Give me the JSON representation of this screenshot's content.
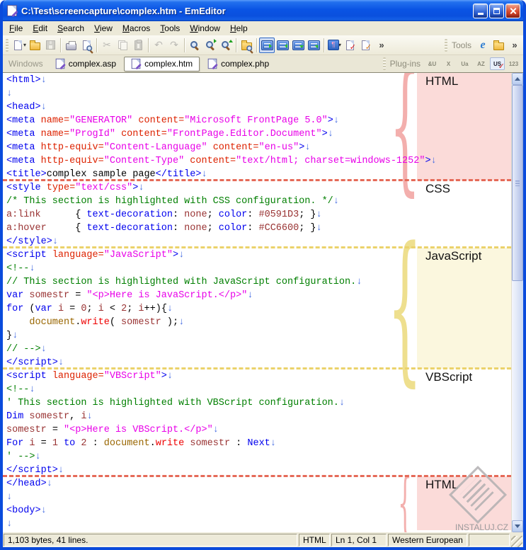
{
  "window": {
    "title": "C:\\Test\\screencapture\\complex.htm - EmEditor"
  },
  "menu": {
    "items": [
      "File",
      "Edit",
      "Search",
      "View",
      "Macros",
      "Tools",
      "Window",
      "Help"
    ]
  },
  "toolbar": {
    "main": [
      {
        "name": "new-file",
        "icon": "page",
        "dropdown": true
      },
      {
        "name": "open-file",
        "icon": "folder"
      },
      {
        "name": "save-file",
        "icon": "floppy",
        "disabled": true
      },
      {
        "sep": true
      },
      {
        "name": "print",
        "icon": "printer"
      },
      {
        "name": "print-preview",
        "icon": "preview"
      },
      {
        "sep": true
      },
      {
        "name": "cut",
        "icon": "scissors",
        "disabled": true
      },
      {
        "name": "copy",
        "icon": "copy",
        "disabled": true
      },
      {
        "name": "paste",
        "icon": "paste",
        "disabled": true
      },
      {
        "sep": true
      },
      {
        "name": "undo",
        "icon": "undo",
        "disabled": true
      },
      {
        "name": "redo",
        "icon": "redo",
        "disabled": true
      },
      {
        "sep": true
      },
      {
        "name": "find",
        "icon": "lens"
      },
      {
        "name": "find-next",
        "icon": "lens-next"
      },
      {
        "name": "find-previous",
        "icon": "lens-prev"
      },
      {
        "sep": true
      },
      {
        "name": "find-in-files",
        "icon": "lens-folder"
      },
      {
        "sep": true
      },
      {
        "name": "no-wrap",
        "icon": "wrap1",
        "selected": true
      },
      {
        "name": "wrap-by-characters",
        "icon": "wrap2"
      },
      {
        "name": "wrap-by-window",
        "icon": "wrap3"
      },
      {
        "name": "wrap-by-page",
        "icon": "wrap4"
      },
      {
        "sep": true
      },
      {
        "name": "show-marks",
        "icon": "marks",
        "dropdown": true
      },
      {
        "name": "quick-macro-record",
        "icon": "macro1"
      },
      {
        "name": "quick-macro-run",
        "icon": "macro2"
      },
      {
        "name": "toolbar-overflow",
        "icon": "chevron"
      }
    ],
    "tools": {
      "label": "Tools",
      "items": [
        {
          "name": "external-tool-internet-explorer",
          "icon": "ie"
        },
        {
          "name": "external-tool-folder",
          "icon": "folder"
        },
        {
          "name": "tools-overflow",
          "icon": "chevron"
        }
      ]
    }
  },
  "tabbar": {
    "windows_label": "Windows",
    "tabs": [
      {
        "label": "complex.asp",
        "active": false
      },
      {
        "label": "complex.htm",
        "active": true
      },
      {
        "label": "complex.php",
        "active": false
      }
    ],
    "plugins_label": "Plug-ins",
    "plugin_icons": [
      {
        "name": "plugin-decode-selection",
        "glyph": "&U",
        "disabled": true
      },
      {
        "name": "plugin-delete-blank-lines",
        "glyph": "X",
        "disabled": true
      },
      {
        "name": "plugin-unicode-convert",
        "glyph": "Ua",
        "disabled": true
      },
      {
        "name": "plugin-sort-az",
        "glyph": "AZ",
        "disabled": true
      },
      {
        "name": "plugin-spelling-us",
        "glyph": "US",
        "disabled": false,
        "check": true
      },
      {
        "name": "plugin-word-count",
        "glyph": "123",
        "disabled": true
      }
    ]
  },
  "editor": {
    "sections": [
      {
        "label": "HTML",
        "highlight": "pink",
        "brace": true,
        "separator_after": "red",
        "lines": [
          [
            [
              "tag",
              "<html>"
            ],
            [
              "nl",
              "↓"
            ]
          ],
          [
            [
              "nl",
              "↓"
            ]
          ],
          [
            [
              "tag",
              "<head>"
            ],
            [
              "nl",
              "↓"
            ]
          ],
          [
            [
              "tag",
              "<meta"
            ],
            [
              "pln",
              " "
            ],
            [
              "attr",
              "name="
            ],
            [
              "val",
              "\"GENERATOR\""
            ],
            [
              "pln",
              " "
            ],
            [
              "attr",
              "content="
            ],
            [
              "val",
              "\"Microsoft FrontPage 5.0\""
            ],
            [
              "tag",
              ">"
            ],
            [
              "nl",
              "↓"
            ]
          ],
          [
            [
              "tag",
              "<meta"
            ],
            [
              "pln",
              " "
            ],
            [
              "attr",
              "name="
            ],
            [
              "val",
              "\"ProgId\""
            ],
            [
              "pln",
              " "
            ],
            [
              "attr",
              "content="
            ],
            [
              "val",
              "\"FrontPage.Editor.Document\""
            ],
            [
              "tag",
              ">"
            ],
            [
              "nl",
              "↓"
            ]
          ],
          [
            [
              "tag",
              "<meta"
            ],
            [
              "pln",
              " "
            ],
            [
              "attr",
              "http-equiv="
            ],
            [
              "val",
              "\"Content-Language\""
            ],
            [
              "pln",
              " "
            ],
            [
              "attr",
              "content="
            ],
            [
              "val",
              "\"en-us\""
            ],
            [
              "tag",
              ">"
            ],
            [
              "nl",
              "↓"
            ]
          ],
          [
            [
              "tag",
              "<meta"
            ],
            [
              "pln",
              " "
            ],
            [
              "attr",
              "http-equiv="
            ],
            [
              "val",
              "\"Content-Type\""
            ],
            [
              "pln",
              " "
            ],
            [
              "attr",
              "content="
            ],
            [
              "val",
              "\"text/html; charset=windows-1252\""
            ],
            [
              "tag",
              ">"
            ],
            [
              "nl",
              "↓"
            ]
          ],
          [
            [
              "tag",
              "<title>"
            ],
            [
              "pln",
              "complex sample page"
            ],
            [
              "tag",
              "</title>"
            ],
            [
              "nl",
              "↓"
            ]
          ]
        ]
      },
      {
        "label": "CSS",
        "highlight": null,
        "brace": false,
        "separator_after": "yellow",
        "lines": [
          [
            [
              "tag",
              "<style"
            ],
            [
              "pln",
              " "
            ],
            [
              "attr",
              "type="
            ],
            [
              "val",
              "\"text/css\""
            ],
            [
              "tag",
              ">"
            ],
            [
              "nl",
              "↓"
            ]
          ],
          [
            [
              "cmt",
              "/* This section is highlighted with CSS configuration. */"
            ],
            [
              "nl",
              "↓"
            ]
          ],
          [
            [
              "id",
              "a:link"
            ],
            [
              "pln",
              "      { "
            ],
            [
              "kw",
              "text-decoration"
            ],
            [
              "pln",
              ": "
            ],
            [
              "id",
              "none"
            ],
            [
              "pln",
              "; "
            ],
            [
              "kw",
              "color"
            ],
            [
              "pln",
              ": "
            ],
            [
              "id",
              "#0591D3"
            ],
            [
              "pln",
              "; }"
            ],
            [
              "nl",
              "↓"
            ]
          ],
          [
            [
              "id",
              "a:hover"
            ],
            [
              "pln",
              "     { "
            ],
            [
              "kw",
              "text-decoration"
            ],
            [
              "pln",
              ": "
            ],
            [
              "id",
              "none"
            ],
            [
              "pln",
              "; "
            ],
            [
              "kw",
              "color"
            ],
            [
              "pln",
              ": "
            ],
            [
              "id",
              "#CC6600"
            ],
            [
              "pln",
              "; }"
            ],
            [
              "nl",
              "↓"
            ]
          ],
          [
            [
              "tag",
              "</style>"
            ],
            [
              "nl",
              "↓"
            ]
          ]
        ]
      },
      {
        "label": "JavaScript",
        "highlight": "yellow",
        "brace": true,
        "separator_after": "yellow",
        "lines": [
          [
            [
              "tag",
              "<script"
            ],
            [
              "pln",
              " "
            ],
            [
              "attr",
              "language="
            ],
            [
              "val",
              "\"JavaScript\""
            ],
            [
              "tag",
              ">"
            ],
            [
              "nl",
              "↓"
            ]
          ],
          [
            [
              "cmt",
              "<!--"
            ],
            [
              "nl",
              "↓"
            ]
          ],
          [
            [
              "cmt",
              "// This section is highlighted with JavaScript configuration."
            ],
            [
              "nl",
              "↓"
            ]
          ],
          [
            [
              "kw",
              "var"
            ],
            [
              "pln",
              " "
            ],
            [
              "id",
              "somestr"
            ],
            [
              "pln",
              " = "
            ],
            [
              "str",
              "\"<p>Here is JavaScript.</p>\""
            ],
            [
              "nl",
              "↓"
            ]
          ],
          [
            [
              "kw",
              "for"
            ],
            [
              "pln",
              " ("
            ],
            [
              "kw",
              "var"
            ],
            [
              "pln",
              " "
            ],
            [
              "id",
              "i"
            ],
            [
              "pln",
              " = "
            ],
            [
              "id",
              "0"
            ],
            [
              "pln",
              "; "
            ],
            [
              "id",
              "i"
            ],
            [
              "pln",
              " < "
            ],
            [
              "id",
              "2"
            ],
            [
              "pln",
              "; "
            ],
            [
              "id",
              "i"
            ],
            [
              "pln",
              "++){"
            ],
            [
              "nl",
              "↓"
            ]
          ],
          [
            [
              "pln",
              "    "
            ],
            [
              "obj",
              "document"
            ],
            [
              "pln",
              "."
            ],
            [
              "fn",
              "write"
            ],
            [
              "pln",
              "( "
            ],
            [
              "id",
              "somestr"
            ],
            [
              "pln",
              " );"
            ],
            [
              "nl",
              "↓"
            ]
          ],
          [
            [
              "pln",
              "}"
            ],
            [
              "nl",
              "↓"
            ]
          ],
          [
            [
              "cmt",
              "// -->"
            ],
            [
              "nl",
              "↓"
            ]
          ],
          [
            [
              "tag",
              "</script>"
            ],
            [
              "nl",
              "↓"
            ]
          ]
        ]
      },
      {
        "label": "VBScript",
        "highlight": null,
        "brace": false,
        "separator_after": "red",
        "lines": [
          [
            [
              "tag",
              "<script"
            ],
            [
              "pln",
              " "
            ],
            [
              "attr",
              "language="
            ],
            [
              "val",
              "\"VBScript\""
            ],
            [
              "tag",
              ">"
            ],
            [
              "nl",
              "↓"
            ]
          ],
          [
            [
              "cmt",
              "<!--"
            ],
            [
              "nl",
              "↓"
            ]
          ],
          [
            [
              "cmt",
              "' This section is highlighted with VBScript configuration."
            ],
            [
              "nl",
              "↓"
            ]
          ],
          [
            [
              "kw",
              "Dim"
            ],
            [
              "pln",
              " "
            ],
            [
              "id",
              "somestr"
            ],
            [
              "pln",
              ", "
            ],
            [
              "id",
              "i"
            ],
            [
              "nl",
              "↓"
            ]
          ],
          [
            [
              "id",
              "somestr"
            ],
            [
              "pln",
              " = "
            ],
            [
              "str",
              "\"<p>Here is VBScript.</p>\""
            ],
            [
              "nl",
              "↓"
            ]
          ],
          [
            [
              "kw",
              "For"
            ],
            [
              "pln",
              " "
            ],
            [
              "id",
              "i"
            ],
            [
              "pln",
              " = "
            ],
            [
              "id",
              "1"
            ],
            [
              "pln",
              " "
            ],
            [
              "kw",
              "to"
            ],
            [
              "pln",
              " "
            ],
            [
              "id",
              "2"
            ],
            [
              "pln",
              " : "
            ],
            [
              "obj",
              "document"
            ],
            [
              "pln",
              "."
            ],
            [
              "fn",
              "write"
            ],
            [
              "pln",
              " "
            ],
            [
              "id",
              "somestr"
            ],
            [
              "pln",
              " : "
            ],
            [
              "kw",
              "Next"
            ],
            [
              "nl",
              "↓"
            ]
          ],
          [
            [
              "cmt",
              "' -->"
            ],
            [
              "nl",
              "↓"
            ]
          ],
          [
            [
              "tag",
              "</script>"
            ],
            [
              "nl",
              "↓"
            ]
          ]
        ]
      },
      {
        "label": "HTML",
        "highlight": "pink",
        "brace": true,
        "separator_after": null,
        "lines": [
          [
            [
              "tag",
              "</head>"
            ],
            [
              "nl",
              "↓"
            ]
          ],
          [
            [
              "nl",
              "↓"
            ]
          ],
          [
            [
              "tag",
              "<body>"
            ],
            [
              "nl",
              "↓"
            ]
          ],
          [
            [
              "nl",
              "↓"
            ]
          ]
        ]
      }
    ]
  },
  "watermark": {
    "text": "INSTALUJ.CZ"
  },
  "statusbar": {
    "panes": [
      {
        "name": "file-info",
        "text": "1,103 bytes, 41 lines."
      },
      {
        "name": "syntax",
        "text": "HTML"
      },
      {
        "name": "cursor-position",
        "text": "Ln 1, Col 1"
      },
      {
        "name": "encoding",
        "text": "Western European"
      },
      {
        "name": "extra",
        "text": ""
      }
    ]
  },
  "colors": {
    "titlebar_blue": "#0A54E4",
    "token_tag": "#0000EE",
    "token_attribute": "#DD2200",
    "token_value": "#E800E8",
    "token_comment": "#007F00",
    "token_keyword": "#0000EE",
    "token_identifier": "#993333",
    "token_string": "#E800E8",
    "token_object": "#996600",
    "token_function": "#EE0000",
    "token_newline_mark": "#4169E1",
    "section_html_bg": "#FBDBD9",
    "section_js_bg": "#FBF7DE",
    "separator_red": "#E56A58",
    "separator_yellow": "#EBD26B"
  }
}
